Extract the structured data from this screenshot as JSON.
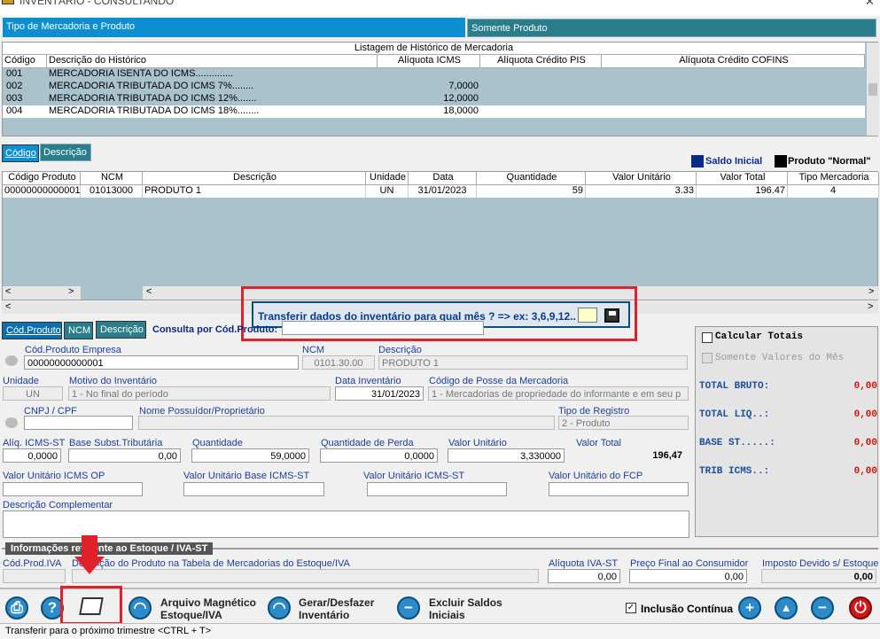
{
  "window": {
    "title": "INVENTÁRIO  -  CONSULTANDO",
    "close": "✕"
  },
  "tabs": [
    "Tipo de Mercadoria e Produto",
    "Somente Produto"
  ],
  "history": {
    "caption": "Listagem de Histórico de Mercadoria",
    "columns": [
      "Código",
      "Descrição do Histórico",
      "Alíquota ICMS",
      "Alíquota Crédito PIS",
      "Alíquota Crédito COFINS"
    ],
    "rows": [
      [
        "001",
        "MERCADORIA ISENTA DO ICMS..............",
        "",
        "",
        ""
      ],
      [
        "002",
        "MERCADORIA TRIBUTADA DO ICMS 7%........",
        "7,0000",
        "",
        ""
      ],
      [
        "003",
        "MERCADORIA TRIBUTADA DO ICMS 12%.......",
        "12,0000",
        "",
        ""
      ],
      [
        "004",
        "MERCADORIA TRIBUTADA DO ICMS 18%........",
        "18,0000",
        "",
        ""
      ]
    ]
  },
  "sort_tabs": [
    "Código",
    "Descrição"
  ],
  "legend": [
    {
      "label": "Saldo Inicial",
      "color": "#0a2a8a"
    },
    {
      "label": "Produto \"Normal\"",
      "color": "#000000"
    }
  ],
  "products": {
    "columns": [
      "Código Produto",
      "NCM",
      "Descrição",
      "Unidade",
      "Data",
      "Quantidade",
      "Valor Unitário",
      "Valor Total",
      "Tipo Mercadoria"
    ],
    "rows": [
      [
        "00000000000001",
        "01013000",
        "PRODUTO 1",
        "UN",
        "31/01/2023",
        "59",
        "3.33",
        "196.47",
        "4"
      ]
    ]
  },
  "popup": {
    "label": "Transferir dados do inventário para qual mês ? => ex: 3,6,9,12..",
    "value": ""
  },
  "search": {
    "tabs": [
      "Cód.Produto",
      "NCM",
      "Descrição"
    ],
    "label": "Consulta por Cód.Produto:"
  },
  "form": {
    "cod_produto_label": "Cód.Produto Empresa",
    "cod_produto": "00000000000001",
    "ncm_label": "NCM",
    "ncm": "0101.30.00",
    "descricao_label": "Descrição",
    "descricao": "PRODUTO 1",
    "unidade_label": "Unidade",
    "unidade": "UN",
    "motivo_label": "Motivo do Inventário",
    "motivo": "1 - No final do período",
    "data_label": "Data Inventário",
    "data": "31/01/2023",
    "posse_label": "Código de Posse da Mercadoria",
    "posse": "1 - Mercadorias de propriedade do informante e em seu p",
    "cnpj_label": "CNPJ / CPF",
    "cnpj": "",
    "possuidor_label": "Nome Possuídor/Proprietário",
    "possuidor": "",
    "tipo_registro_label": "Tipo de Registro",
    "tipo_registro": "2 - Produto",
    "aliq_icms_st_label": "Alíq. ICMS-ST",
    "aliq_icms_st": "0,0000",
    "base_subst_label": "Base Subst.Tributária",
    "base_subst": "0,00",
    "quantidade_label": "Quantidade",
    "quantidade": "59,0000",
    "qtd_perda_label": "Quantidade de Perda",
    "qtd_perda": "0,0000",
    "valor_unit_label": "Valor Unitário",
    "valor_unit": "3,330000",
    "valor_total_label": "Valor Total",
    "valor_total": "196,47",
    "vu_icms_op_label": "Valor Unitário ICMS OP",
    "vu_base_icms_st_label": "Valor Unitário Base ICMS-ST",
    "vu_icms_st_label": "Valor Unitário ICMS-ST",
    "vu_fcp_label": "Valor Unitário do FCP",
    "desc_compl_label": "Descrição Complementar",
    "section_label": "Informações referente ao Estoque / IVA-ST",
    "cod_prod_iva_label": "Cód.Prod.IVA",
    "desc_tabela_label": "Descrição do Produto na Tabela de Mercadorias do Estoque/IVA",
    "aliq_iva_label": "Alíquota IVA-ST",
    "aliq_iva": "0,00",
    "preco_final_label": "Preço Final ao Consumidor",
    "preco_final": "0,00",
    "imposto_label": "Imposto Devido s/ Estoque",
    "imposto": "0,00"
  },
  "totals": {
    "calc_label": "Calcular Totais",
    "somente_label": "Somente Valores do Mês",
    "items": [
      {
        "label": "TOTAL BRUTO:",
        "value": "0,00"
      },
      {
        "label": "TOTAL LIQ..:",
        "value": "0,00"
      },
      {
        "label": "BASE ST.....:",
        "value": "0,00"
      },
      {
        "label": "TRIB ICMS..:",
        "value": "0,00"
      }
    ]
  },
  "toolbar": {
    "arquivo_line1": "Arquivo Magnético",
    "arquivo_line2": "Estoque/IVA",
    "gerar_line1": "Gerar/Desfazer",
    "gerar_line2": "Inventário",
    "excluir_line1": "Excluir Saldos",
    "excluir_line2": "Iniciais",
    "inclusao_label": "Inclusão Contínua"
  },
  "status": "Transferir para o próximo trimestre <CTRL + T>"
}
